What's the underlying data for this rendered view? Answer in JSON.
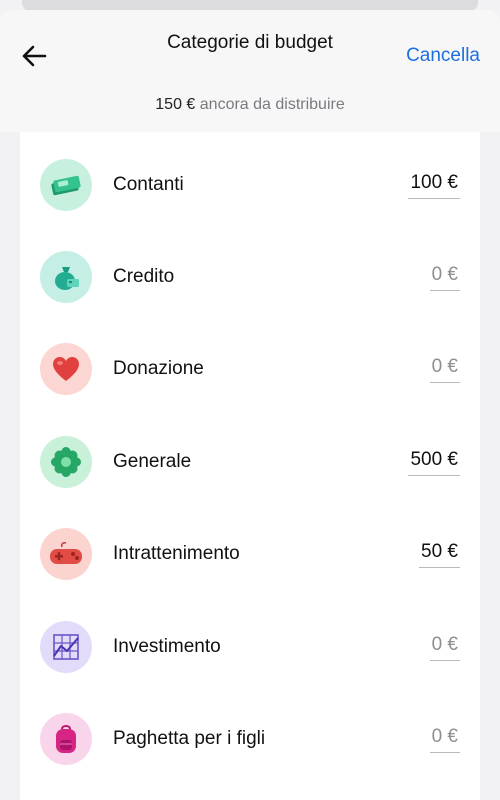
{
  "header": {
    "title": "Categorie di budget",
    "cancel_label": "Cancella",
    "remaining_amount": "150 €",
    "remaining_text": "ancora da distribuire"
  },
  "categories": [
    {
      "label": "Contanti",
      "value": "100 €",
      "icon": "cash-icon",
      "bg": "#c8f0df"
    },
    {
      "label": "Credito",
      "value": "0 €",
      "icon": "money-bag-icon",
      "bg": "#c5efe4"
    },
    {
      "label": "Donazione",
      "value": "0 €",
      "icon": "heart-icon",
      "bg": "#fbd6d2"
    },
    {
      "label": "Generale",
      "value": "500 €",
      "icon": "clover-icon",
      "bg": "#c9f0d8"
    },
    {
      "label": "Intrattenimento",
      "value": "50 €",
      "icon": "gamepad-icon",
      "bg": "#fbd3cf"
    },
    {
      "label": "Investimento",
      "value": "0 €",
      "icon": "chart-grid-icon",
      "bg": "#e2dcfa"
    },
    {
      "label": "Paghetta per i figli",
      "value": "0 €",
      "icon": "backpack-icon",
      "bg": "#f9d5ec"
    }
  ]
}
